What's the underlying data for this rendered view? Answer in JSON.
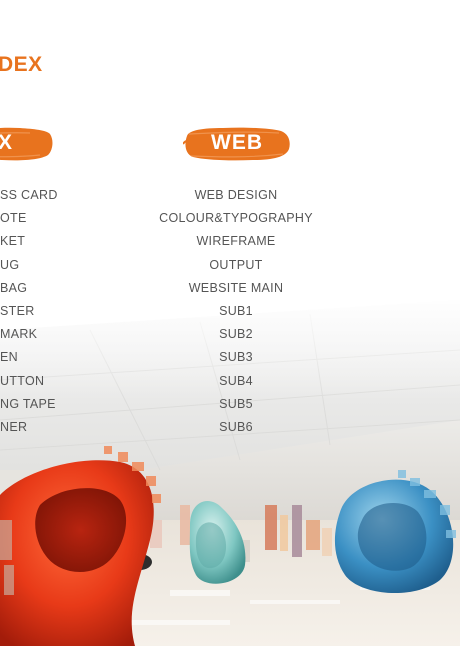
{
  "colors": {
    "accent": "#E8731E",
    "text": "#555555",
    "brush_white": "#FFFFFF"
  },
  "header": {
    "index_title": "DEX"
  },
  "left_column": {
    "heading": "X",
    "items": [
      "SS CARD",
      "OTE",
      "KET",
      "UG",
      "BAG",
      "STER",
      "MARK",
      "EN",
      "UTTON",
      "NG TAPE",
      "NER"
    ]
  },
  "right_column": {
    "heading": "WEB",
    "items": [
      "WEB DESIGN",
      "COLOUR&TYPOGRAPHY",
      "WIREFRAME",
      "OUTPUT",
      "WEBSITE MAIN",
      "SUB1",
      "SUB2",
      "SUB3",
      "SUB4",
      "SUB5",
      "SUB6"
    ]
  }
}
